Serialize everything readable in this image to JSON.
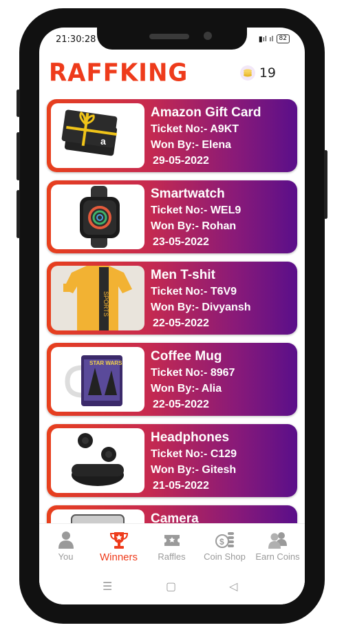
{
  "status_bar": {
    "time": "21:30:28",
    "battery": "82"
  },
  "app": {
    "logo": "RAFFKING",
    "coins": "19",
    "coin_icon": "coin-stack-icon"
  },
  "colors": {
    "accent": "#ee3b1b",
    "card_start": "#e8401c",
    "card_end": "#5a0f8a",
    "inactive": "#9a9a9a"
  },
  "winners": [
    {
      "title": "Amazon Gift Card",
      "ticket": "Ticket No:- A9KT",
      "won_by": "Won By:- Elena",
      "date": "29-05-2022",
      "image": "gift-card-image"
    },
    {
      "title": "Smartwatch",
      "ticket": "Ticket No:- WEL9",
      "won_by": "Won By:- Rohan",
      "date": "23-05-2022",
      "image": "smartwatch-image"
    },
    {
      "title": "Men T-shit",
      "ticket": "Ticket No:- T6V9",
      "won_by": "Won By:- Divyansh",
      "date": "22-05-2022",
      "image": "tshirt-image"
    },
    {
      "title": "Coffee Mug",
      "ticket": "Ticket No:- 8967",
      "won_by": "Won By:- Alia",
      "date": "22-05-2022",
      "image": "coffee-mug-image"
    },
    {
      "title": "Headphones",
      "ticket": "Ticket No:- C129",
      "won_by": "Won By:- Gitesh",
      "date": "21-05-2022",
      "image": "earbuds-image"
    },
    {
      "title": "Camera",
      "ticket": "",
      "won_by": "",
      "date": "",
      "image": "camera-image"
    }
  ],
  "tabs": [
    {
      "label": "You",
      "icon": "person-icon"
    },
    {
      "label": "Winners",
      "icon": "trophy-icon",
      "active": true
    },
    {
      "label": "Raffles",
      "icon": "ticket-icon"
    },
    {
      "label": "Coin Shop",
      "icon": "coin-shop-icon"
    },
    {
      "label": "Earn Coins",
      "icon": "users-icon"
    }
  ],
  "nav": {
    "menu": "☰",
    "home": "▢",
    "back": "◁"
  }
}
